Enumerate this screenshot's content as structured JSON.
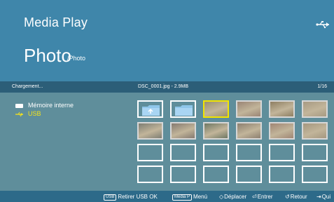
{
  "header": {
    "app_title": "Media Play",
    "page_title": "Photo",
    "path": "/Photo"
  },
  "status": {
    "left": "Chargement...",
    "center": "DSC_0001.jpg - 2.9MB",
    "right": "1/16"
  },
  "sources": {
    "items": [
      {
        "label": "Mémoire interne",
        "icon": "memory-icon",
        "active": false
      },
      {
        "label": "USB",
        "icon": "usb-icon",
        "active": true
      }
    ]
  },
  "grid": {
    "rows": 4,
    "cols": 6,
    "cells": [
      {
        "type": "folder",
        "icon": "folder-up-icon"
      },
      {
        "type": "folder",
        "icon": "folder-icon"
      },
      {
        "type": "image",
        "selected": true,
        "color": "#9a9071"
      },
      {
        "type": "image",
        "color": "#9a8575"
      },
      {
        "type": "image",
        "color": "#8e7f62"
      },
      {
        "type": "image",
        "color": "#a79a83"
      },
      {
        "type": "image",
        "color": "#7e7e73"
      },
      {
        "type": "image",
        "color": "#857a70"
      },
      {
        "type": "image",
        "color": "#6f7863"
      },
      {
        "type": "image",
        "color": "#8d8070"
      },
      {
        "type": "image",
        "color": "#9f8674"
      },
      {
        "type": "image",
        "color": "#a4977f"
      },
      {
        "type": "empty"
      },
      {
        "type": "empty"
      },
      {
        "type": "empty"
      },
      {
        "type": "empty"
      },
      {
        "type": "empty"
      },
      {
        "type": "empty"
      },
      {
        "type": "empty"
      },
      {
        "type": "empty"
      },
      {
        "type": "empty"
      },
      {
        "type": "empty"
      },
      {
        "type": "empty"
      },
      {
        "type": "empty"
      }
    ]
  },
  "footer": {
    "remove_key": "USB",
    "remove_label": "Retirer USB OK",
    "menu_key": "Media P",
    "menu_label": "Menú",
    "move_label": "Déplacer",
    "enter_label": "Entrer",
    "back_label": "Retour",
    "quit_label": "Qui"
  },
  "colors": {
    "header_bg": "#3f86aa",
    "content_bg": "#5f8e9b",
    "status_bg": "#2c5e78",
    "footer_bg": "#2d6a89",
    "selection": "#f2e400",
    "active_source": "#f3e21c"
  }
}
